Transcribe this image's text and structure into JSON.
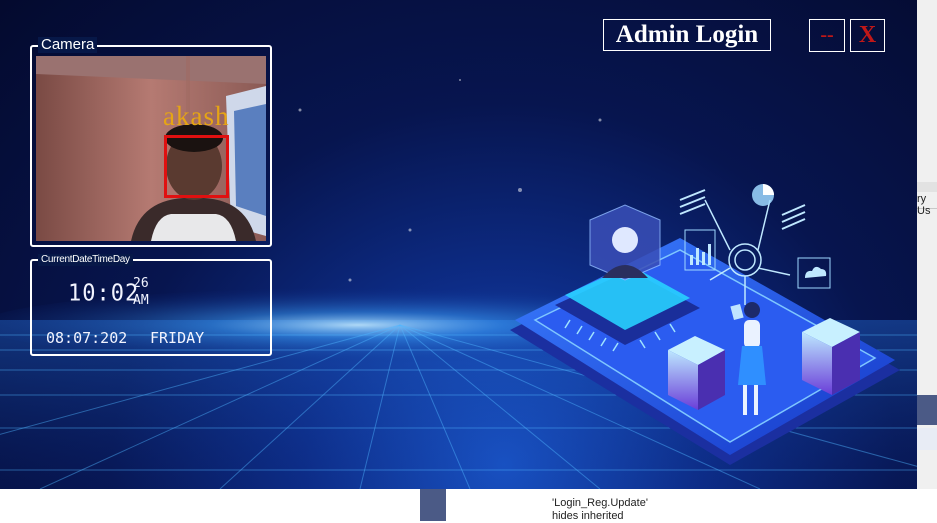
{
  "window": {
    "admin_login_label": "Admin Login",
    "minimize_label": "--",
    "close_label": "X"
  },
  "camera": {
    "legend": "Camera",
    "recognized_name": "akash",
    "box_color": "#e01010",
    "name_color": "#e6a514"
  },
  "datetime": {
    "legend": "CurrentDateTimeDay",
    "time_hm": "10:02",
    "seconds": "26",
    "ampm": "AM",
    "date": "08:07:202",
    "day": "FRIDAY"
  },
  "background_ide": {
    "code_snippet": "'Login_Reg.Update' hides inherited",
    "right_text": "ry Us"
  },
  "colors": {
    "accent": "#1a55c8",
    "background": "#040a2e"
  }
}
